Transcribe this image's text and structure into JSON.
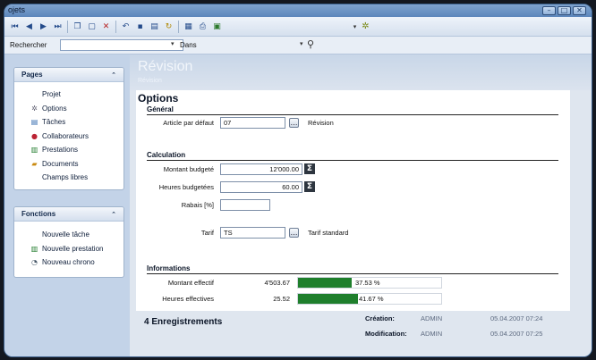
{
  "window": {
    "title": "ojets",
    "controls": [
      "minimize",
      "maximize",
      "close"
    ]
  },
  "toolbar": {
    "icons": [
      "first-icon",
      "prev-icon",
      "next-icon",
      "last-icon",
      "copy-icon",
      "new-icon",
      "delete-icon",
      "undo-icon",
      "save-icon",
      "save-as-icon",
      "refresh-icon",
      "table-icon",
      "print-icon",
      "excel-icon",
      "favorites-icon"
    ]
  },
  "search": {
    "label": "Rechercher",
    "value": "",
    "in_label": "Dans",
    "in_value": ""
  },
  "sidebar": {
    "pages": {
      "title": "Pages",
      "items": [
        {
          "label": "Projet",
          "icon": ""
        },
        {
          "label": "Options",
          "icon": "gear-icon"
        },
        {
          "label": "Tâches",
          "icon": "tasks-icon"
        },
        {
          "label": "Collaborateurs",
          "icon": "users-icon"
        },
        {
          "label": "Prestations",
          "icon": "prestations-icon"
        },
        {
          "label": "Documents",
          "icon": "folder-icon"
        },
        {
          "label": "Champs libres",
          "icon": ""
        }
      ]
    },
    "fonctions": {
      "title": "Fonctions",
      "items": [
        {
          "label": "Nouvelle tâche",
          "icon": ""
        },
        {
          "label": "Nouvelle prestation",
          "icon": "prestations-icon"
        },
        {
          "label": "Nouveau chrono",
          "icon": "chrono-icon"
        }
      ]
    }
  },
  "header": {
    "title": "Révision",
    "subtitle": "Révision"
  },
  "options": {
    "title": "Options",
    "general": {
      "title": "Général",
      "article_label": "Article par défaut",
      "article_value": "07",
      "article_desc": "Révision"
    },
    "calculation": {
      "title": "Calculation",
      "montant_label": "Montant budgeté",
      "montant_value": "12'000.00",
      "heures_label": "Heures budgetées",
      "heures_value": "60.00",
      "rabais_label": "Rabais [%]",
      "rabais_value": "",
      "tarif_label": "Tarif",
      "tarif_value": "TS",
      "tarif_desc": "Tarif standard"
    },
    "informations": {
      "title": "Informations",
      "montant_label": "Montant effectif",
      "montant_value": "4'503.67",
      "montant_pct": "37.53 %",
      "montant_fraction": 0.3753,
      "heures_label": "Heures effectives",
      "heures_value": "25.52",
      "heures_pct": "41.67 %",
      "heures_fraction": 0.4167
    }
  },
  "footer": {
    "count": "4 Enregistrements",
    "creation_label": "Création:",
    "creation_user": "ADMIN",
    "creation_date": "05.04.2007 07:24",
    "modification_label": "Modification:",
    "modification_user": "ADMIN",
    "modification_date": "05.04.2007 07:25"
  },
  "colors": {
    "accent": "#5c86bb",
    "progress": "#1f7f2c",
    "sidebar": "#c3d3e8"
  }
}
